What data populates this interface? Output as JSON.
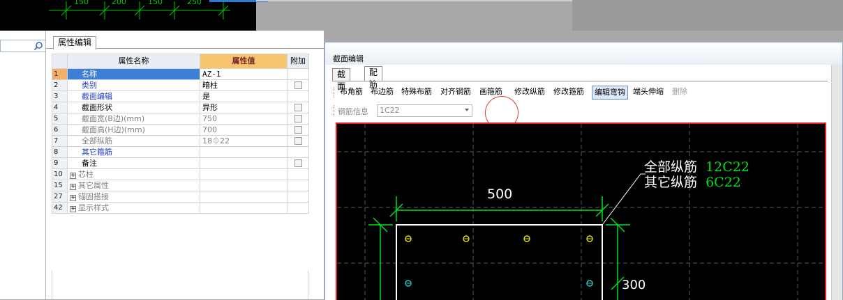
{
  "background_cad": {
    "dims": [
      "150",
      "200",
      "150",
      "250"
    ]
  },
  "search": {
    "placeholder": ""
  },
  "property_editor": {
    "tab_label": "属性编辑",
    "columns": {
      "name": "属性名称",
      "value": "属性值",
      "extra": "附加"
    },
    "rows": [
      {
        "idx": "1",
        "name": "名称",
        "value": "AZ-1",
        "style": "normal",
        "checkbox": false
      },
      {
        "idx": "2",
        "name": "类别",
        "value": "暗柱",
        "style": "blue",
        "checkbox": true
      },
      {
        "idx": "3",
        "name": "截面编辑",
        "value": "是",
        "style": "blue",
        "checkbox": false
      },
      {
        "idx": "4",
        "name": "截面形状",
        "value": "异形",
        "style": "normal",
        "checkbox": true
      },
      {
        "idx": "5",
        "name": "截面宽(B边)(mm)",
        "value": "750",
        "style": "gray",
        "checkbox": true
      },
      {
        "idx": "6",
        "name": "截面高(H边)(mm)",
        "value": "700",
        "style": "gray",
        "checkbox": true
      },
      {
        "idx": "7",
        "name": "全部纵筋",
        "value": "18⏀22",
        "style": "gray",
        "checkbox": true
      },
      {
        "idx": "8",
        "name": "其它箍筋",
        "value": "",
        "style": "blue",
        "checkbox": false
      },
      {
        "idx": "9",
        "name": "备注",
        "value": "",
        "style": "normal",
        "checkbox": true
      },
      {
        "idx": "10",
        "name": "芯柱",
        "value": "",
        "style": "group",
        "checkbox": false
      },
      {
        "idx": "15",
        "name": "其它属性",
        "value": "",
        "style": "group",
        "checkbox": false
      },
      {
        "idx": "27",
        "name": "锚固搭接",
        "value": "",
        "style": "group",
        "checkbox": false
      },
      {
        "idx": "42",
        "name": "显示样式",
        "value": "",
        "style": "group",
        "checkbox": false
      }
    ]
  },
  "section_editor": {
    "title": "截面编辑",
    "tabs": [
      "截面",
      "配筋"
    ],
    "toolbar": [
      "布角筋",
      "布边筋",
      "特殊布筋",
      "对齐钢筋",
      "画箍筋",
      "修改纵筋",
      "修改箍筋",
      "编辑弯钩",
      "端头伸缩",
      "删除"
    ],
    "active_tool": "编辑弯钩",
    "circled_tool": "画箍筋",
    "rebar_info_label": "钢筋信息",
    "rebar_info_value": "1C22",
    "canvas": {
      "annot_total_label": "全部纵筋",
      "annot_total_value": "12C22",
      "annot_other_label": "其它纵筋",
      "annot_other_value": "6C22",
      "dim_top": "500",
      "dim_right": "300"
    }
  },
  "colors": {
    "accent_blue": "#3d7fd6",
    "header_value_bg": "#f7c56f",
    "canvas_bg": "#000000",
    "canvas_border": "#ee1c1c",
    "dim_green": "#00e020",
    "rebar_yellow": "#e8e020",
    "rebar_cyan": "#2ec8c8"
  }
}
